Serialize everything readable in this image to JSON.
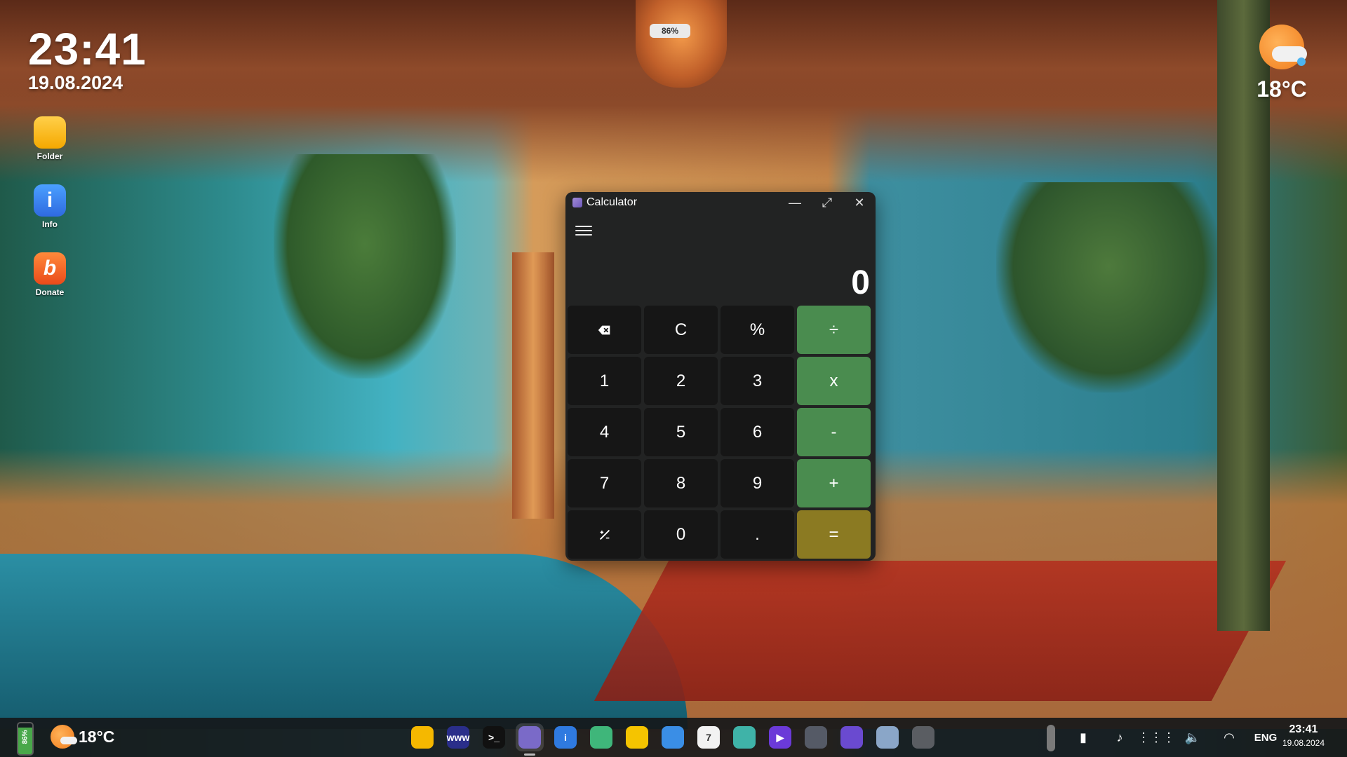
{
  "desktop": {
    "clock": {
      "time": "23:41",
      "date": "19.08.2024"
    },
    "weather": {
      "temp": "18°C",
      "icon": "partly-cloudy-icon"
    },
    "lantern_badge": "86%",
    "icons": [
      {
        "label": "Folder",
        "icon": "folder-icon",
        "color": "#f5b800"
      },
      {
        "label": "Info",
        "icon": "info-icon",
        "color": "#2f7ae0"
      },
      {
        "label": "Donate",
        "icon": "donate-icon",
        "color": "#f26b2a"
      }
    ]
  },
  "calculator": {
    "title": "Calculator",
    "display": "0",
    "keys": [
      {
        "label": "",
        "icon": "backspace-icon",
        "kind": "fn"
      },
      {
        "label": "C",
        "kind": "fn"
      },
      {
        "label": "%",
        "kind": "fn"
      },
      {
        "label": "÷",
        "kind": "op"
      },
      {
        "label": "1",
        "kind": "num"
      },
      {
        "label": "2",
        "kind": "num"
      },
      {
        "label": "3",
        "kind": "num"
      },
      {
        "label": "x",
        "kind": "op"
      },
      {
        "label": "4",
        "kind": "num"
      },
      {
        "label": "5",
        "kind": "num"
      },
      {
        "label": "6",
        "kind": "num"
      },
      {
        "label": "-",
        "kind": "op"
      },
      {
        "label": "7",
        "kind": "num"
      },
      {
        "label": "8",
        "kind": "num"
      },
      {
        "label": "9",
        "kind": "num"
      },
      {
        "label": "+",
        "kind": "op"
      },
      {
        "label": "",
        "icon": "sign-toggle-icon",
        "kind": "fn"
      },
      {
        "label": "0",
        "kind": "num"
      },
      {
        "label": ".",
        "kind": "num"
      },
      {
        "label": "=",
        "kind": "eq"
      }
    ],
    "colors": {
      "operator": "#4a8c4f",
      "equals": "#8b7a22"
    }
  },
  "taskbar": {
    "battery": {
      "text": "86%",
      "level": 0.86
    },
    "weather_temp": "18°C",
    "dock": [
      {
        "name": "files-app",
        "icon": "folder-icon",
        "glyph": "",
        "color": "#f5b800"
      },
      {
        "name": "browser-app",
        "icon": "browser-icon",
        "glyph": "www",
        "color": "#2a2e8a"
      },
      {
        "name": "terminal-app",
        "icon": "terminal-icon",
        "glyph": ">_",
        "color": "#111111"
      },
      {
        "name": "calculator-app",
        "icon": "calculator-icon",
        "glyph": "",
        "color": "#7a6ac8"
      },
      {
        "name": "info-app",
        "icon": "info-icon",
        "glyph": "i",
        "color": "#2f7ae0"
      },
      {
        "name": "game-app",
        "icon": "gamepad-icon",
        "glyph": "",
        "color": "#3fb67a"
      },
      {
        "name": "notes-app",
        "icon": "list-icon",
        "glyph": "",
        "color": "#f5c400"
      },
      {
        "name": "weather-app",
        "icon": "weather-icon",
        "glyph": "",
        "color": "#3a8ee6"
      },
      {
        "name": "calendar-app",
        "icon": "calendar-icon",
        "glyph": "7",
        "color": "#f2f2f2"
      },
      {
        "name": "photos-app",
        "icon": "image-icon",
        "glyph": "",
        "color": "#3fb3a8"
      },
      {
        "name": "video-app",
        "icon": "play-icon",
        "glyph": "▶",
        "color": "#6b3ad8"
      },
      {
        "name": "camera-app",
        "icon": "camera-icon",
        "glyph": "",
        "color": "#555a66"
      },
      {
        "name": "paint-app",
        "icon": "paint-icon",
        "glyph": "",
        "color": "#6a4ad0"
      },
      {
        "name": "settings-app",
        "icon": "gear-icon",
        "glyph": "",
        "color": "#8aa6c8"
      },
      {
        "name": "trash-app",
        "icon": "trash-icon",
        "glyph": "",
        "color": "#5a5d62"
      }
    ],
    "tray": [
      {
        "name": "window-switch",
        "icon": "window-icon",
        "glyph": "▮"
      },
      {
        "name": "music",
        "icon": "music-note-icon",
        "glyph": "♪"
      },
      {
        "name": "app-grid",
        "icon": "grid-icon",
        "glyph": "⋮⋮⋮"
      },
      {
        "name": "volume",
        "icon": "speaker-icon",
        "glyph": "🔈"
      },
      {
        "name": "wifi",
        "icon": "wifi-icon",
        "glyph": "◠"
      }
    ],
    "language": "ENG",
    "clock": {
      "time": "23:41",
      "date": "19.08.2024"
    }
  }
}
